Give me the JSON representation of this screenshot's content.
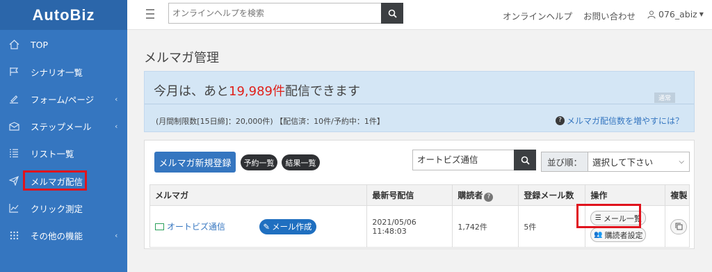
{
  "app": {
    "logo": "AutoBiz"
  },
  "sidebar": {
    "items": [
      {
        "label": "TOP",
        "icon": "home-icon"
      },
      {
        "label": "シナリオ一覧",
        "icon": "flag-icon"
      },
      {
        "label": "フォーム/ページ",
        "icon": "pencil-icon",
        "chevron": "‹"
      },
      {
        "label": "ステップメール",
        "icon": "envelope-icon",
        "chevron": "‹"
      },
      {
        "label": "リスト一覧",
        "icon": "list-icon"
      },
      {
        "label": "メルマガ配信",
        "icon": "send-icon"
      },
      {
        "label": "クリック測定",
        "icon": "chart-icon"
      },
      {
        "label": "その他の機能",
        "icon": "grid-icon",
        "chevron": "‹"
      }
    ]
  },
  "header": {
    "search_placeholder": "オンラインヘルプを検索",
    "help_link": "オンラインヘルプ",
    "contact_link": "お問い合わせ",
    "user": "076_abiz"
  },
  "page": {
    "title": "メルマガ管理"
  },
  "info": {
    "prefix": "今月は、あと",
    "count": "19,989件",
    "suffix": "配信できます",
    "badge": "通常",
    "detail": "(月間制限数[15日締]：20,000件) 【配信済：10件/予約中：1件】",
    "link": "メルマガ配信数を増やすには？"
  },
  "toolbar": {
    "new_button": "メルマガ新規登録",
    "reserved_button": "予約一覧",
    "results_button": "結果一覧",
    "filter_value": "オートビズ通信",
    "sort_label": "並び順：",
    "sort_value": "選択して下さい"
  },
  "table": {
    "headers": [
      "メルマガ",
      "最新号配信",
      "購読者",
      "登録メール数",
      "操作",
      "複製"
    ],
    "rows": [
      {
        "name": "オートビズ通信",
        "compose": "メール作成",
        "latest": "2021/05/06 11:48:03",
        "subscribers": "1,742件",
        "mails": "5件",
        "op_list": "メール一覧",
        "op_settings": "購読者設定"
      }
    ]
  },
  "colors": {
    "sidebar": "#3576c0",
    "highlight": "#e0131d",
    "accent_red": "#e0211b"
  }
}
